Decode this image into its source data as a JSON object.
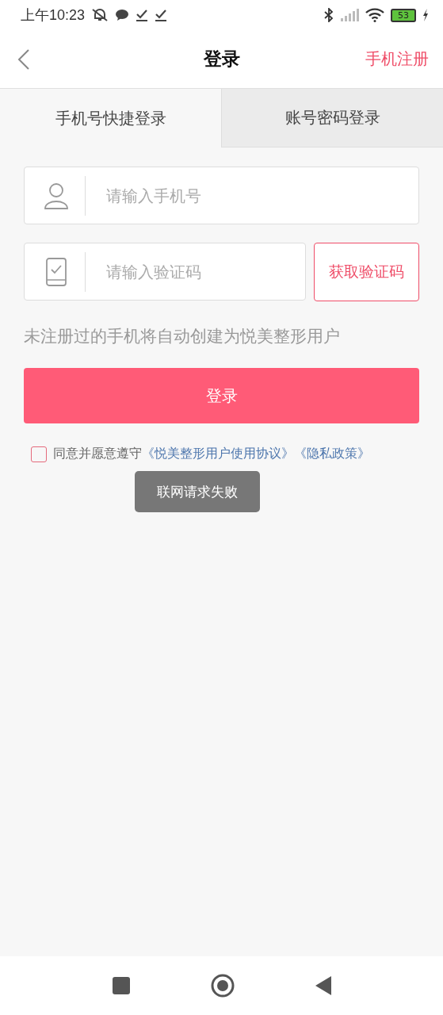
{
  "status_bar": {
    "time": "上午10:23",
    "battery": "53"
  },
  "nav": {
    "title": "登录",
    "action": "手机注册"
  },
  "tabs": [
    {
      "label": "手机号快捷登录",
      "selected": true
    },
    {
      "label": "账号密码登录",
      "selected": false
    }
  ],
  "phone_field": {
    "placeholder": "请输入手机号"
  },
  "code_field": {
    "placeholder": "请输入验证码"
  },
  "code_button": "获取验证码",
  "hint": "未注册过的手机将自动创建为悦美整形用户",
  "login_button": "登录",
  "agreement": {
    "checked": false,
    "text": "同意并愿意遵守",
    "links": [
      "《悦美整形用户使用协议》",
      "《隐私政策》"
    ]
  },
  "toast": "联网请求失败"
}
